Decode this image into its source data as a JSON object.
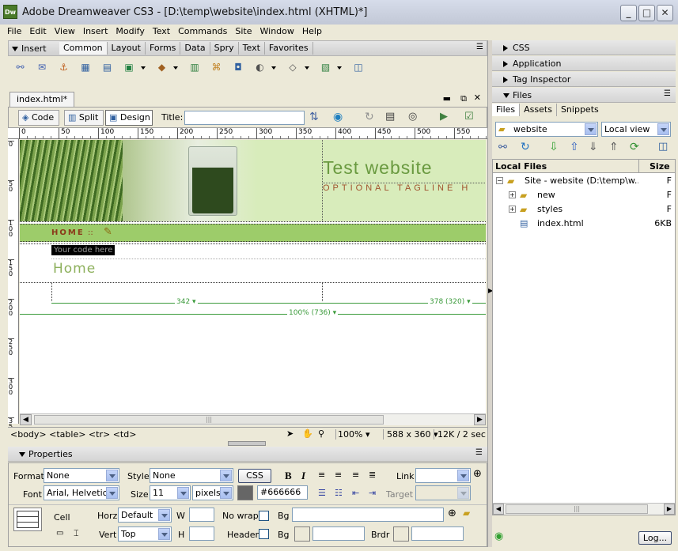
{
  "window": {
    "title": "Adobe Dreamweaver CS3 - [D:\\temp\\website\\index.html (XHTML)*]",
    "app_badge": "Dw"
  },
  "menubar": [
    "File",
    "Edit",
    "View",
    "Insert",
    "Modify",
    "Text",
    "Commands",
    "Site",
    "Window",
    "Help"
  ],
  "insert_bar": {
    "label": "Insert",
    "tabs": [
      "Common",
      "Layout",
      "Forms",
      "Data",
      "Spry",
      "Text",
      "Favorites"
    ],
    "active_tab": "Common"
  },
  "document": {
    "tab_name": "index.html*",
    "view_buttons": {
      "code": "Code",
      "split": "Split",
      "design": "Design"
    },
    "title_label": "Title:",
    "title_value": "",
    "ruler_labels": [
      "0",
      "50",
      "100",
      "150",
      "200",
      "250",
      "300",
      "350",
      "400",
      "450",
      "500",
      "550"
    ],
    "vruler_labels": [
      "0",
      "5 0",
      "1 0 0",
      "1 5 0",
      "2 0 0",
      "2 5 0",
      "3 0 0",
      "3 5 0"
    ]
  },
  "page": {
    "site_title": "Test website",
    "tagline": "OPTIONAL TAGLINE H",
    "nav_home": "HOME",
    "nav_sep": "::",
    "code_label": "Your code here",
    "heading": "Home",
    "width_342": "342",
    "width_378": "378 (320)",
    "width_100": "100% (736)"
  },
  "statusbar": {
    "tags": "<body> <table> <tr> <td>",
    "zoom": "100%",
    "size": "588 x 360",
    "download": "12K / 2 sec"
  },
  "properties": {
    "title": "Properties",
    "format_label": "Format",
    "format_value": "None",
    "style_label": "Style",
    "style_value": "None",
    "css_button": "CSS",
    "bold": "B",
    "italic": "I",
    "link_label": "Link",
    "link_value": "",
    "font_label": "Font",
    "font_value": "Arial, Helvetica",
    "size_label": "Size",
    "size_value": "11",
    "unit_value": "pixels",
    "color_value": "#666666",
    "target_label": "Target",
    "cell_label": "Cell",
    "horz_label": "Horz",
    "horz_value": "Default",
    "w_label": "W",
    "nowrap_label": "No wrap",
    "bg_label": "Bg",
    "vert_label": "Vert",
    "vert_value": "Top",
    "h_label": "H",
    "header_label": "Header",
    "brdr_label": "Brdr"
  },
  "right_panels": {
    "css": "CSS",
    "application": "Application",
    "tag_inspector": "Tag Inspector",
    "files": "Files",
    "files_tabs": [
      "Files",
      "Assets",
      "Snippets"
    ],
    "site_select": "website",
    "view_select": "Local view",
    "col_local": "Local Files",
    "col_size": "Size",
    "tree": [
      {
        "label": "Site - website (D:\\temp\\w...",
        "size": "F",
        "level": 0,
        "type": "site"
      },
      {
        "label": "new",
        "size": "F",
        "level": 1,
        "type": "folder"
      },
      {
        "label": "styles",
        "size": "F",
        "level": 1,
        "type": "folder"
      },
      {
        "label": "index.html",
        "size": "6KB",
        "level": 1,
        "type": "file"
      }
    ],
    "log_button": "Log..."
  },
  "colors": {
    "accent_green": "#8db05c",
    "header_green": "#d6ebb8",
    "nav_green": "#9dcc6a",
    "tag_text": "#8b3a1a"
  }
}
